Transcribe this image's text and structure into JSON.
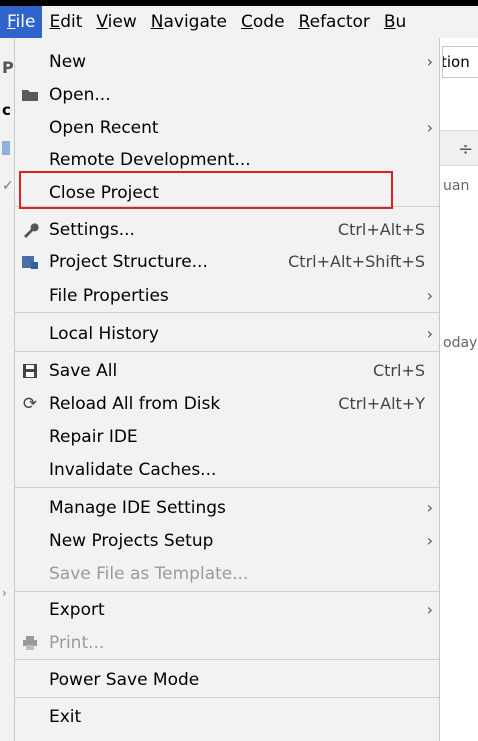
{
  "menubar": {
    "items": [
      {
        "label": "File",
        "mnemonic": "F",
        "rest": "ile",
        "active": true
      },
      {
        "label": "Edit",
        "mnemonic": "E",
        "rest": "dit",
        "active": false
      },
      {
        "label": "View",
        "mnemonic": "V",
        "rest": "iew",
        "active": false
      },
      {
        "label": "Navigate",
        "mnemonic": "N",
        "rest": "avigate",
        "active": false
      },
      {
        "label": "Code",
        "mnemonic": "C",
        "rest": "ode",
        "active": false
      },
      {
        "label": "Refactor",
        "mnemonic": "R",
        "rest": "efactor",
        "active": false
      },
      {
        "label": "Bu",
        "mnemonic": "B",
        "rest": "u",
        "active": false
      }
    ]
  },
  "background": {
    "field_text": "tion",
    "text1": "uan",
    "text2": "oday"
  },
  "menu": {
    "new": {
      "label": "New",
      "arrow": "›"
    },
    "open": {
      "label": "Open..."
    },
    "open_recent": {
      "label": "Open Recent",
      "arrow": "›"
    },
    "remote_dev": {
      "label": "Remote Development..."
    },
    "close_project": {
      "label": "Close Project"
    },
    "settings": {
      "label": "Settings...",
      "shortcut": "Ctrl+Alt+S"
    },
    "project_structure": {
      "label": "Project Structure...",
      "shortcut": "Ctrl+Alt+Shift+S"
    },
    "file_properties": {
      "label": "File Properties",
      "arrow": "›"
    },
    "local_history": {
      "label": "Local History",
      "arrow": "›"
    },
    "save_all": {
      "label": "Save All",
      "shortcut": "Ctrl+S"
    },
    "reload_all": {
      "label": "Reload All from Disk",
      "shortcut": "Ctrl+Alt+Y"
    },
    "repair_ide": {
      "label": "Repair IDE"
    },
    "invalidate_caches": {
      "label": "Invalidate Caches..."
    },
    "manage_ide_settings": {
      "label": "Manage IDE Settings",
      "arrow": "›"
    },
    "new_projects_setup": {
      "label": "New Projects Setup",
      "arrow": "›"
    },
    "save_file_template": {
      "label": "Save File as Template..."
    },
    "export": {
      "label": "Export",
      "arrow": "›"
    },
    "print": {
      "label": "Print..."
    },
    "power_save_mode": {
      "label": "Power Save Mode"
    },
    "exit": {
      "label": "Exit"
    }
  },
  "colors": {
    "active_menu": "#2f65ca",
    "highlight_box": "#e02020",
    "menu_bg": "#f2f2f2"
  }
}
